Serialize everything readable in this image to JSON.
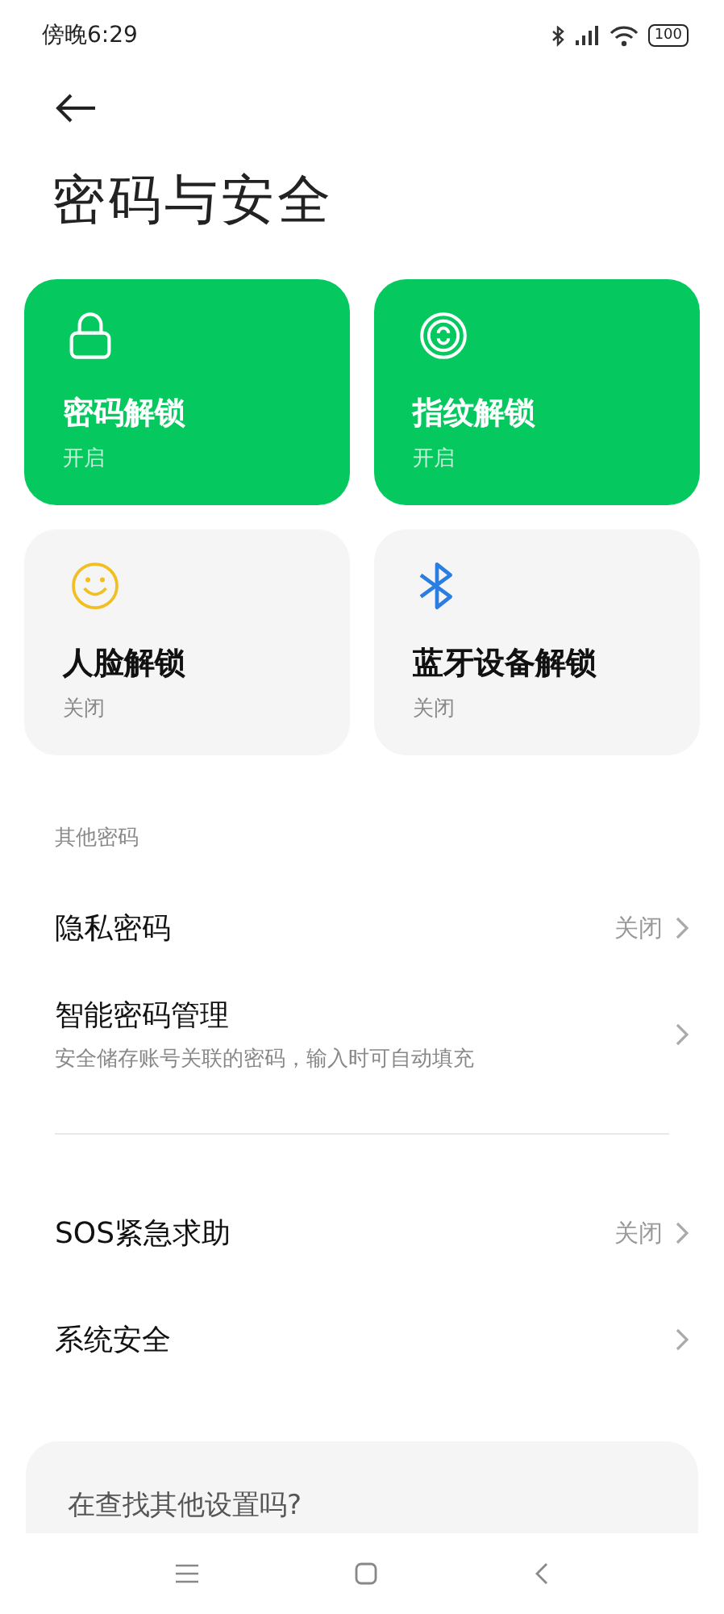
{
  "status_bar": {
    "time": "傍晚6:29",
    "battery": "100"
  },
  "title": "密码与安全",
  "tiles": [
    {
      "kind": "lock",
      "label": "密码解锁",
      "status": "开启",
      "on": true
    },
    {
      "kind": "fingerprint",
      "label": "指纹解锁",
      "status": "开启",
      "on": true
    },
    {
      "kind": "face",
      "label": "人脸解锁",
      "status": "关闭",
      "on": false
    },
    {
      "kind": "bluetooth",
      "label": "蓝牙设备解锁",
      "status": "关闭",
      "on": false
    }
  ],
  "section_label": "其他密码",
  "groups": [
    [
      {
        "label": "隐私密码",
        "value": "关闭"
      },
      {
        "label": "智能密码管理",
        "subtitle": "安全储存账号关联的密码，输入时可自动填充"
      }
    ],
    [
      {
        "label": "SOS紧急求助",
        "value": "关闭"
      },
      {
        "label": "系统安全"
      }
    ]
  ],
  "suggestion": {
    "title": "在查找其他设置吗?"
  }
}
